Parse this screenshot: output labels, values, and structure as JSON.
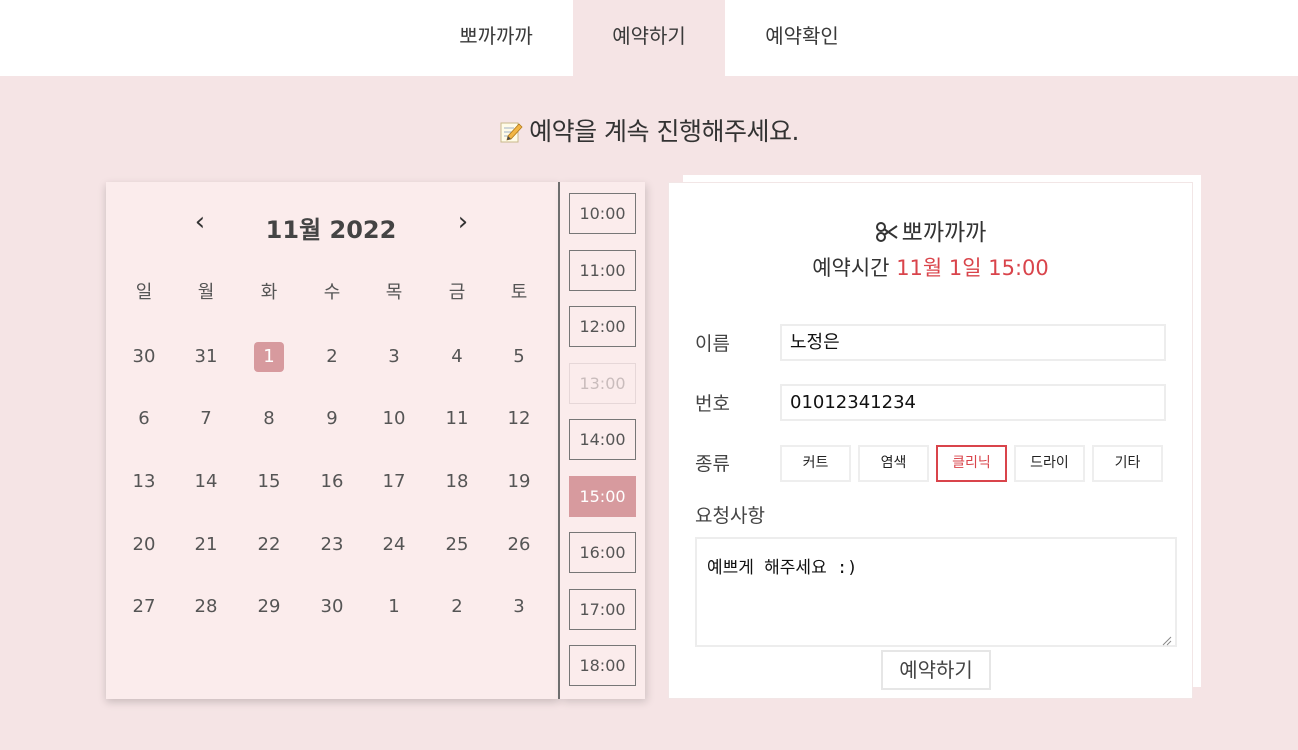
{
  "nav": {
    "tabs": [
      {
        "label": "뽀까까까"
      },
      {
        "label": "예약하기"
      },
      {
        "label": "예약확인"
      }
    ]
  },
  "heading": "예약을 계속 진행해주세요.",
  "calendar": {
    "title": "11월 2022",
    "prev": "‹",
    "next": "›",
    "weekdays": [
      "일",
      "월",
      "화",
      "수",
      "목",
      "금",
      "토"
    ],
    "weeks": [
      [
        "30",
        "31",
        "1",
        "2",
        "3",
        "4",
        "5"
      ],
      [
        "6",
        "7",
        "8",
        "9",
        "10",
        "11",
        "12"
      ],
      [
        "13",
        "14",
        "15",
        "16",
        "17",
        "18",
        "19"
      ],
      [
        "20",
        "21",
        "22",
        "23",
        "24",
        "25",
        "26"
      ],
      [
        "27",
        "28",
        "29",
        "30",
        "1",
        "2",
        "3"
      ]
    ],
    "selected_day": "1"
  },
  "times": {
    "slots": [
      "10:00",
      "11:00",
      "12:00",
      "13:00",
      "14:00",
      "15:00",
      "16:00",
      "17:00",
      "18:00"
    ],
    "disabled": [
      "13:00"
    ],
    "selected": "15:00"
  },
  "form": {
    "shop_name": "뽀까까까",
    "rtime_label": "예약시간",
    "rtime_value": "11월 1일 15:00",
    "name_label": "이름",
    "name_value": "노정은",
    "phone_label": "번호",
    "phone_value": "01012341234",
    "type_label": "종류",
    "types": [
      "커트",
      "염색",
      "클리닉",
      "드라이",
      "기타"
    ],
    "selected_type": "클리닉",
    "request_label": "요청사항",
    "request_value": "예쁘게 해주세요 :)",
    "submit_label": "예약하기"
  },
  "colors": {
    "accent": "#d9444b",
    "selected_bg": "#d79a9e",
    "page_bg": "#f5e4e5",
    "calendar_bg": "#fbecec"
  }
}
